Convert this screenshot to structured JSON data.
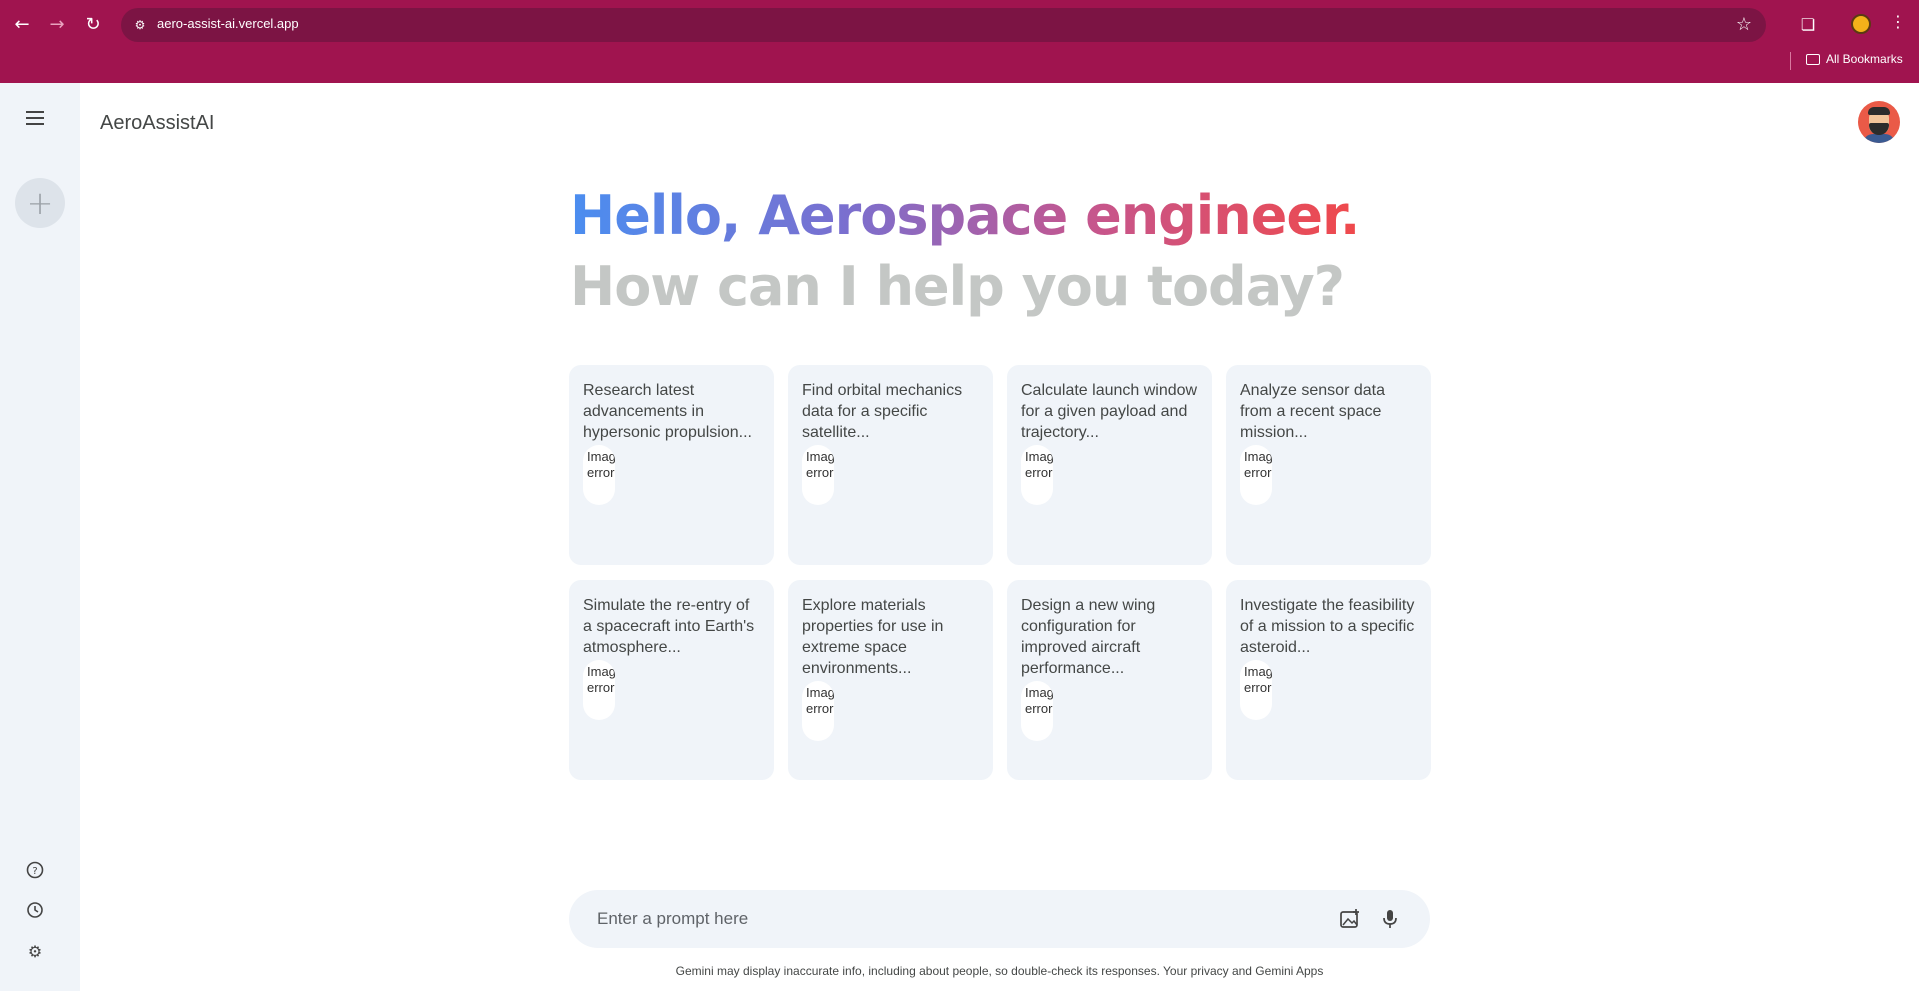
{
  "browser": {
    "url": "aero-assist-ai.vercel.app",
    "bookmarks_label": "All Bookmarks"
  },
  "app": {
    "title": "AeroAssistAI"
  },
  "greeting": {
    "hello": "Hello, Aerospace engineer.",
    "question": "How can I help you today?"
  },
  "cards": [
    {
      "text": "Research latest advancements in hypersonic propulsion...",
      "img_alt": "Image error"
    },
    {
      "text": "Find orbital mechanics data for a specific satellite...",
      "img_alt": "Image error"
    },
    {
      "text": "Calculate launch window for a given payload and trajectory...",
      "img_alt": "Image error"
    },
    {
      "text": "Analyze sensor data from a recent space mission...",
      "img_alt": "Image error"
    },
    {
      "text": "Simulate the re-entry of a spacecraft into Earth's atmosphere...",
      "img_alt": "Image error"
    },
    {
      "text": "Explore materials properties for use in extreme space environments...",
      "img_alt": "Image error"
    },
    {
      "text": "Design a new wing configuration for improved aircraft performance...",
      "img_alt": "Image error"
    },
    {
      "text": "Investigate the feasibility of a mission to a specific asteroid...",
      "img_alt": "Image error"
    }
  ],
  "prompt": {
    "placeholder": "Enter a prompt here"
  },
  "footer": {
    "disclaimer": "Gemini may display inaccurate info, including about people, so double-check its responses. Your privacy and Gemini Apps"
  },
  "icons": {
    "back": "arrow-left-icon",
    "forward": "arrow-right-icon",
    "reload": "reload-icon",
    "menu": "menu-icon",
    "new_chat": "plus-icon",
    "help": "help-icon",
    "history": "history-icon",
    "settings": "gear-icon",
    "gallery": "image-add-icon",
    "mic": "mic-icon"
  },
  "colors": {
    "chrome": "#a0144f",
    "omnibox": "#7c1444",
    "sidebar": "#f0f4f9",
    "gradient_start": "#4b8ef0",
    "gradient_end": "#f0494b"
  }
}
